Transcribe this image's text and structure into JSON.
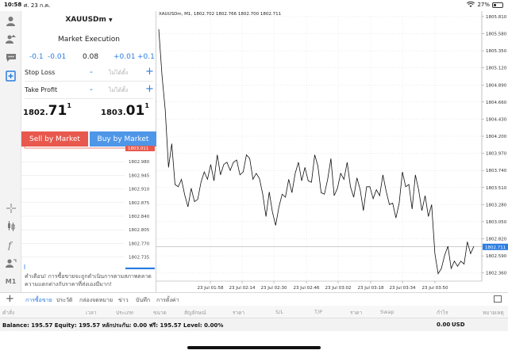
{
  "status": {
    "time": "10:58",
    "date": "ศ. 23 ก.ค.",
    "battery": "27%",
    "icons": [
      "wifi-icon",
      "battery-icon"
    ]
  },
  "left_toolbar": {
    "m1_label": "M1"
  },
  "panel": {
    "symbol": "XAUUSDm",
    "execution": "Market Execution",
    "volume": {
      "minus_large": "-0.1",
      "minus_small": "-0.01",
      "value": "0.08",
      "plus_small": "+0.01",
      "plus_large": "+0.1"
    },
    "stop_loss": {
      "label": "Stop Loss",
      "minus": "-",
      "value": "ไม่ได้ตั้ง",
      "plus": "+"
    },
    "take_profit": {
      "label": "Take Profit",
      "minus": "-",
      "value": "ไม่ได้ตั้ง",
      "plus": "+"
    },
    "sell_price": {
      "small": "1802.",
      "big": "71",
      "sup": "1"
    },
    "buy_price": {
      "small": "1803.",
      "big": "01",
      "sup": "1"
    },
    "sell_label": "Sell by Market",
    "buy_label": "Buy by Market",
    "mini_ticks": [
      "1803.011",
      "1802.980",
      "1802.945",
      "1802.910",
      "1802.875",
      "1802.840",
      "1802.805",
      "1802.770",
      "1802.735",
      "1802.711"
    ],
    "warning": "คำเตือน! การซื้อขายจะถูกดำเนินการตามสภาพตลาด ความแตกต่างกับราคาที่ส่งเองมีมาก!"
  },
  "chart": {
    "info": "XAUUSDm, M1, 1802.702 1802.766 1802.700 1802.711",
    "current_price": "1802.711"
  },
  "tabs": {
    "items": [
      "การซื้อขาย",
      "ประวัติ",
      "กล่องจดหมาย",
      "ข่าว",
      "บันทึก",
      "การตั้งค่า"
    ],
    "active": 0
  },
  "table_header": [
    "คำสั่ง",
    "เวลา",
    "ประเภท",
    "ขนาด",
    "สัญลักษณ์",
    "ราคา",
    "S/L",
    "T/P",
    "ราคา",
    "Swap",
    "กำไร",
    "หมายเหตุ"
  ],
  "balance": {
    "text": "Balance: 195.57 Equity: 195.57 หลักประกัน: 0.00 ฟรี: 195.57 Level: 0.00%",
    "amount": "0.00",
    "currency": "USD"
  },
  "chart_data": {
    "type": "line",
    "ylim": [
      1802.25,
      1805.82
    ],
    "y_ticks": [
      "1805.810",
      "1805.580",
      "1805.350",
      "1805.120",
      "1804.890",
      "1804.660",
      "1804.430",
      "1804.200",
      "1803.970",
      "1803.740",
      "1803.510",
      "1803.280",
      "1803.050",
      "1802.820",
      "1802.590",
      "1802.360"
    ],
    "x_ticks": [
      "23 Jul 01:58",
      "23 Jul 02:14",
      "23 Jul 02:30",
      "23 Jul 02:46",
      "23 Jul 03:02",
      "23 Jul 03:18",
      "23 Jul 03:34",
      "23 Jul 03:50"
    ],
    "current_price": 1802.711,
    "values": [
      1805.64,
      1805.02,
      1804.55,
      1803.78,
      1804.1,
      1803.55,
      1803.52,
      1803.62,
      1803.41,
      1803.25,
      1803.5,
      1803.32,
      1803.35,
      1803.58,
      1803.72,
      1803.62,
      1803.82,
      1803.6,
      1803.95,
      1803.68,
      1803.82,
      1803.85,
      1803.74,
      1803.85,
      1803.88,
      1803.68,
      1803.72,
      1803.95,
      1803.9,
      1803.62,
      1803.7,
      1803.63,
      1803.42,
      1803.12,
      1803.45,
      1803.18,
      1803.0,
      1803.25,
      1803.42,
      1803.38,
      1803.62,
      1803.44,
      1803.7,
      1803.85,
      1803.6,
      1803.78,
      1803.6,
      1803.58,
      1803.95,
      1803.8,
      1803.44,
      1803.42,
      1803.62,
      1803.9,
      1803.4,
      1803.5,
      1803.7,
      1803.62,
      1803.85,
      1803.52,
      1803.38,
      1803.64,
      1803.48,
      1803.2,
      1803.52,
      1803.52,
      1803.36,
      1803.48,
      1803.4,
      1803.68,
      1803.46,
      1803.28,
      1803.3,
      1803.1,
      1803.3,
      1803.72,
      1803.52,
      1803.55,
      1803.22,
      1803.68,
      1803.48,
      1803.2,
      1803.4,
      1803.12,
      1803.28,
      1802.62,
      1802.35,
      1802.42,
      1802.6,
      1802.72,
      1802.42,
      1802.52,
      1802.45,
      1802.52,
      1802.48,
      1802.78,
      1802.62,
      1802.72
    ]
  }
}
